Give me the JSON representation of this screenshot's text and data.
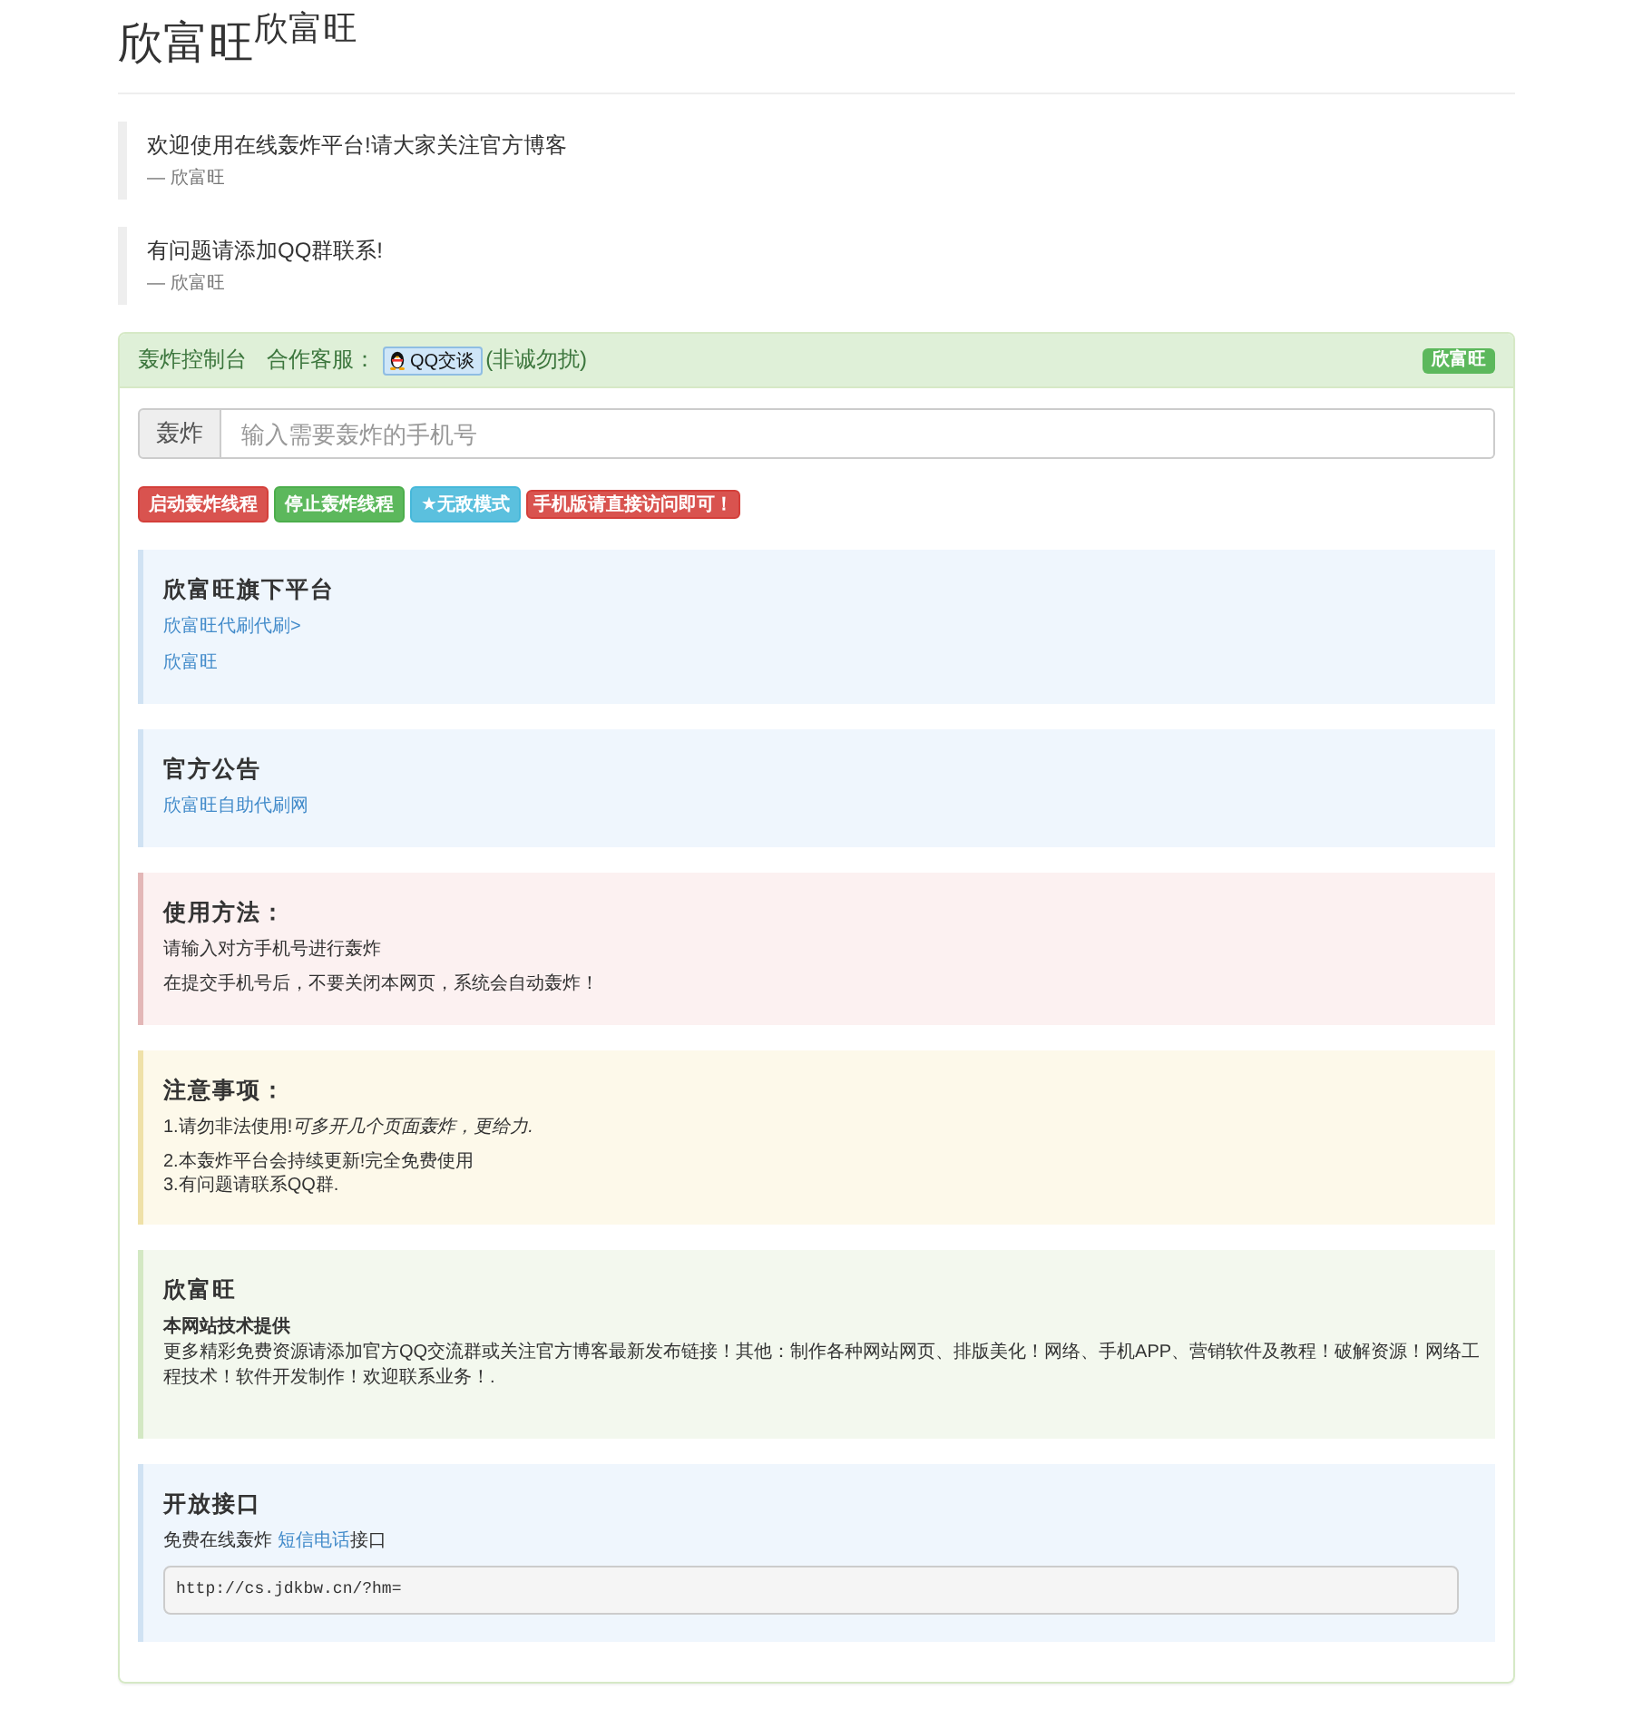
{
  "header": {
    "title": "欣富旺",
    "subtitle": "欣富旺"
  },
  "quotes": [
    {
      "text": "欢迎使用在线轰炸平台!请大家关注官方博客",
      "source": "— 欣富旺"
    },
    {
      "text": "有问题请添加QQ群联系!",
      "source": "— 欣富旺"
    }
  ],
  "panel": {
    "title": "轰炸控制台",
    "service_label": "合作客服：",
    "qq_button": "QQ交谈",
    "note": "(非诚勿扰)",
    "badge": "欣富旺",
    "search": {
      "addon": "轰炸",
      "placeholder": "输入需要轰炸的手机号"
    },
    "buttons": [
      {
        "label": "启动轰炸线程",
        "kind": "danger"
      },
      {
        "label": "停止轰炸线程",
        "kind": "success"
      },
      {
        "label": "★无敌模式",
        "kind": "info"
      },
      {
        "label": "手机版请直接访问即可！",
        "kind": "danger-small"
      }
    ],
    "callouts": [
      {
        "kind": "info",
        "title": "欣富旺旗下平台",
        "items": [
          {
            "kind": "link",
            "text": "欣富旺代刷代刷>"
          },
          {
            "kind": "link",
            "text": "欣富旺"
          }
        ]
      },
      {
        "kind": "info",
        "title": "官方公告",
        "items": [
          {
            "kind": "link",
            "text": "欣富旺自助代刷网"
          }
        ]
      },
      {
        "kind": "danger",
        "title": "使用方法：",
        "items": [
          {
            "kind": "text",
            "text": "请输入对方手机号进行轰炸"
          },
          {
            "kind": "text",
            "text": "在提交手机号后，不要关闭本网页，系统会自动轰炸！"
          }
        ]
      },
      {
        "kind": "warning",
        "title": "注意事项：",
        "items": [
          {
            "kind": "text",
            "text": "1.请勿非法使用!*可多开几个页面轰炸，更给力.*"
          },
          {
            "kind": "lines",
            "lines": [
              "2.本轰炸平台会持续更新!完全免费使用",
              "3.有问题请联系QQ群."
            ]
          }
        ]
      },
      {
        "kind": "success",
        "title": "欣富旺",
        "items": [
          {
            "kind": "strong",
            "text": "本网站技术提供"
          },
          {
            "kind": "text",
            "text": "更多精彩免费资源请添加官方QQ交流群或关注官方博客最新发布链接！其他：制作各种网站网页、排版美化！网络、手机APP、营销软件及教程！破解资源！网络工程技术！软件开发制作！欢迎联系业务！."
          }
        ]
      },
      {
        "kind": "info",
        "title": "开放接口",
        "items": [
          {
            "kind": "link_text",
            "before": "免费在线轰炸 ",
            "link": "短信电话",
            "after": "接口"
          },
          {
            "kind": "code",
            "text": "http://cs.jdkbw.cn/?hm="
          }
        ]
      }
    ]
  }
}
